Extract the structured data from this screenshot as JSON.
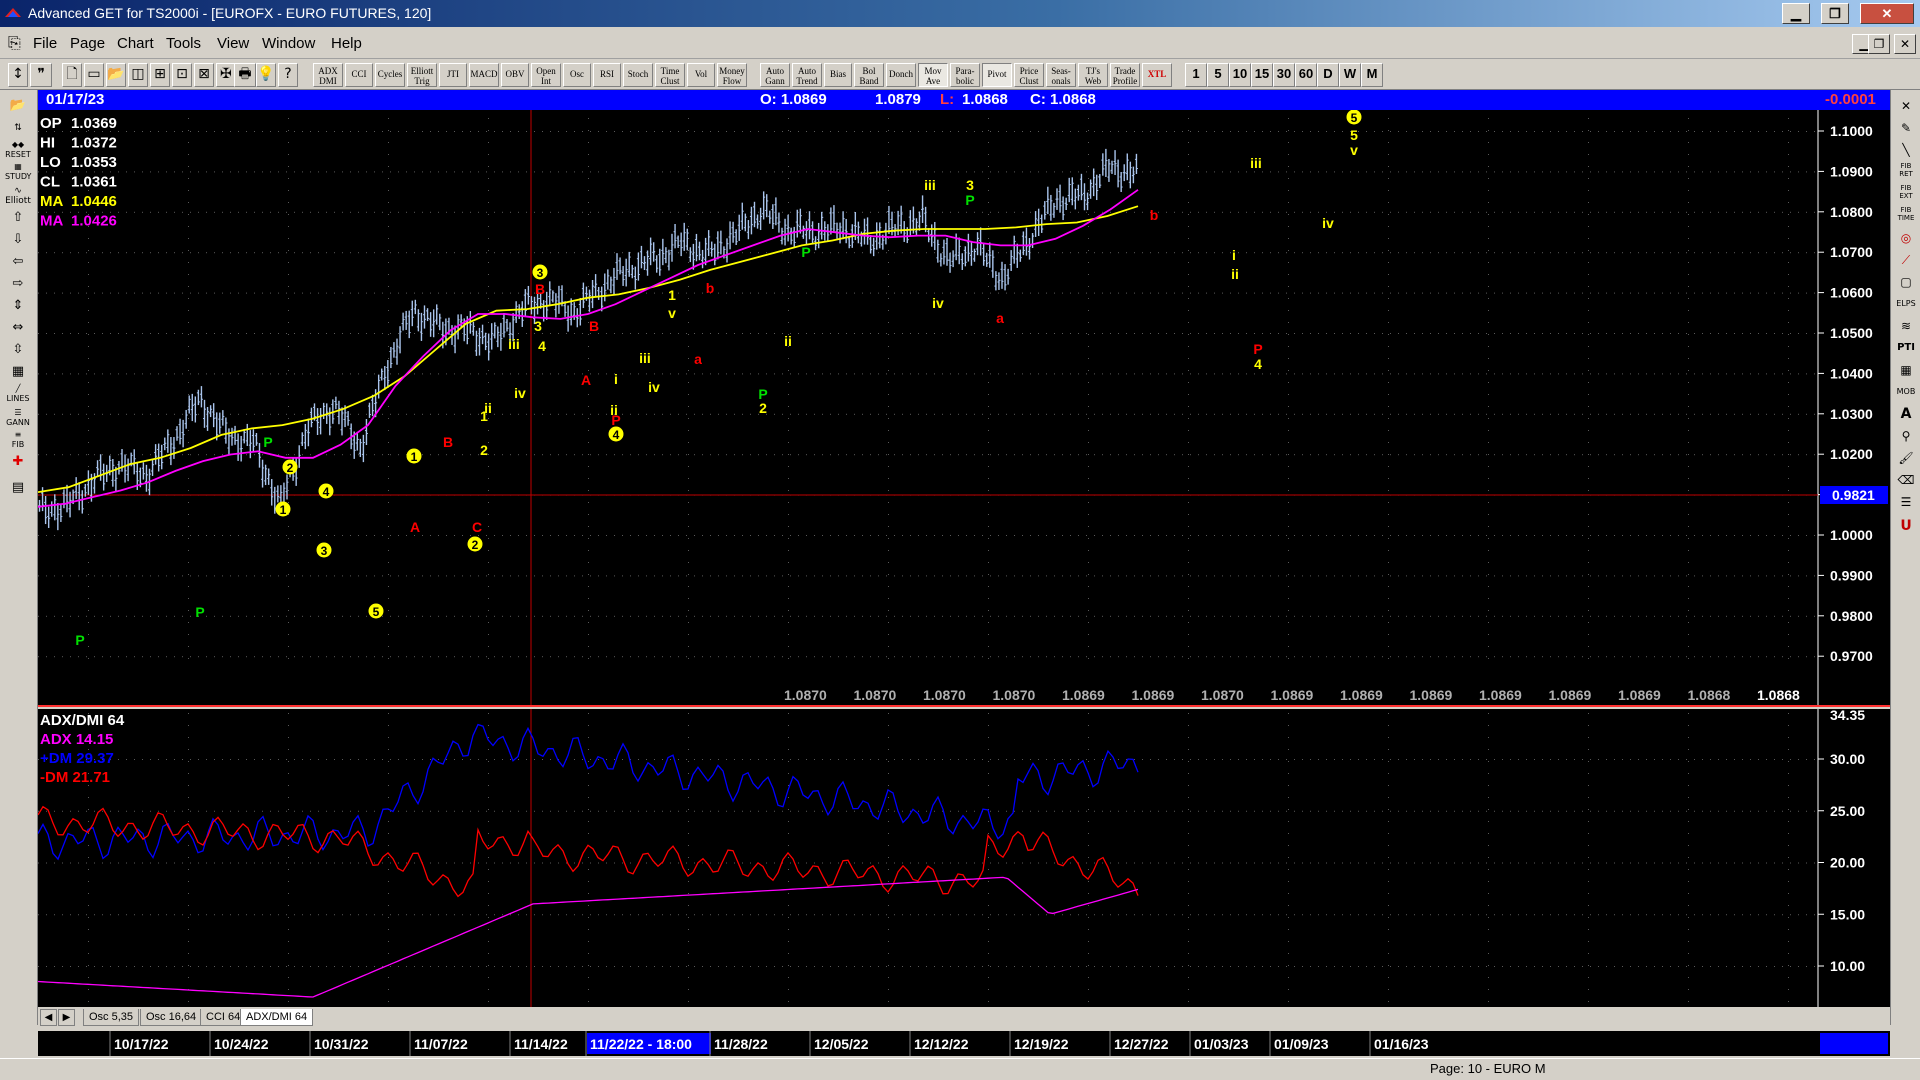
{
  "window": {
    "title": "Advanced GET for TS2000i - [EUROFX - EURO FUTURES, 120]",
    "min": "▁",
    "max": "❐",
    "close": "✕"
  },
  "menu": [
    "File",
    "Page",
    "Chart",
    "Tools",
    "View",
    "Window",
    "Help"
  ],
  "mdi_buttons": [
    "▁",
    "❐",
    "✕"
  ],
  "toolbar": {
    "icon_buttons": [
      "↕",
      "❞",
      "🗋",
      "▭",
      "📂",
      "◫",
      "⊞",
      "⊡",
      "⊠",
      "✠",
      "🖶",
      "💡",
      "?"
    ],
    "study_buttons": [
      "ADX DMI",
      "CCI",
      "Cycles",
      "Elliott Trig",
      "JTI",
      "MACD",
      "OBV",
      "Open Int",
      "Osc",
      "RSI",
      "Stoch",
      "Time Clust",
      "Vol",
      "Money Flow",
      "Auto Gann",
      "Auto Trend",
      "Bias",
      "Bol Band",
      "Donch",
      "Mov Ave",
      "Para- bolic",
      "Pivot",
      "Price Clust",
      "Seas- onals",
      "TJ's Web",
      "Trade Profile",
      "XTL"
    ],
    "timeframes": [
      "1",
      "5",
      "10",
      "15",
      "30",
      "60",
      "D",
      "W",
      "M"
    ]
  },
  "info_bar": {
    "date": "01/17/23",
    "open": "O: 1.0869",
    "high": "1.0879",
    "low_label": "L:",
    "low": "1.0868",
    "close": "C: 1.0868",
    "change": "-0.0001"
  },
  "legend": [
    {
      "label": "OP",
      "value": "1.0369",
      "color": "#ffffff"
    },
    {
      "label": "HI",
      "value": "1.0372",
      "color": "#ffffff"
    },
    {
      "label": "LO",
      "value": "1.0353",
      "color": "#ffffff"
    },
    {
      "label": "CL",
      "value": "1.0361",
      "color": "#ffffff"
    },
    {
      "label": "MA",
      "value": "1.0446",
      "color": "#ffff00"
    },
    {
      "label": "MA",
      "value": "1.0426",
      "color": "#ff00ff"
    }
  ],
  "price_axis": [
    "1.1000",
    "1.0900",
    "1.0800",
    "1.0700",
    "1.0600",
    "1.0500",
    "1.0400",
    "1.0300",
    "1.0200",
    "1.0100",
    "1.0000",
    "0.9900",
    "0.9800",
    "0.9700"
  ],
  "cursor_price": "0.9821",
  "price_strip": [
    "1.0870",
    "1.0870",
    "1.0870",
    "1.0870",
    "1.0869",
    "1.0869",
    "1.0870",
    "1.0869",
    "1.0869",
    "1.0869",
    "1.0869",
    "1.0869",
    "1.0869",
    "1.0868",
    "1.0868"
  ],
  "osc_legend": {
    "title": "ADX/DMI 64",
    "adx": "ADX 14.15",
    "pdm": "+DM 29.37",
    "mdm": "-DM 21.71"
  },
  "osc_axis": [
    "34.35",
    "30.00",
    "25.00",
    "20.00",
    "15.00",
    "10.00"
  ],
  "osc_tabs": [
    "Osc 5,35",
    "Osc 16,64",
    "CCI 64",
    "ADX/DMI 64"
  ],
  "dates": [
    "10/17/22",
    "10/24/22",
    "10/31/22",
    "11/07/22",
    "11/14/22",
    "11/22/22 - 18:00",
    "11/28/22",
    "12/05/22",
    "12/12/22",
    "12/19/22",
    "12/27/22",
    "01/03/23",
    "01/09/23",
    "01/16/23"
  ],
  "status": {
    "page": "Page: 10 - EURO M"
  },
  "colors": {
    "price": "#a9c4ec",
    "ma_fast": "#ffff00",
    "ma_slow": "#ff00ff",
    "adx": "#ff00ff",
    "pdm": "#0000ff",
    "mdm": "#ff0000",
    "label_yellow": "#ffff00",
    "label_red": "#ff0000",
    "label_green": "#00e000"
  },
  "chart_data": {
    "type": "ohlc",
    "series": [
      {
        "name": "Price",
        "values": [
          0.9838,
          0.9852,
          0.993,
          0.9978,
          0.9948,
          1.0052,
          1.018,
          1.0069,
          1.0045,
          0.9852,
          1.0088,
          1.0158,
          1.0032,
          1.0285,
          1.045,
          1.0396,
          1.0391,
          1.0354,
          1.0452,
          1.0487,
          1.0445,
          1.0521,
          1.0578,
          1.0608,
          1.066,
          1.062,
          1.0683,
          1.076,
          1.0694,
          1.0693,
          1.0705,
          1.0665,
          1.0706,
          1.0726,
          1.06,
          1.065,
          1.0547,
          1.0673,
          1.079,
          1.0802,
          1.089,
          1.0868
        ]
      },
      {
        "name": "MA",
        "values": [
          0.9895,
          0.991,
          0.9945,
          0.998,
          1.0,
          1.003,
          1.007,
          1.009,
          1.01,
          1.012,
          1.015,
          1.019,
          1.025,
          1.033,
          1.041,
          1.045,
          1.0455,
          1.047,
          1.049,
          1.05,
          1.052,
          1.0545,
          1.0575,
          1.06,
          1.0625,
          1.065,
          1.0665,
          1.0685,
          1.0695,
          1.07,
          1.07,
          1.07,
          1.0705,
          1.0715,
          1.072,
          1.074,
          1.077
        ]
      },
      {
        "name": "MA",
        "values": [
          0.985,
          0.986,
          0.988,
          0.99,
          0.9925,
          0.996,
          0.999,
          1.001,
          1.002,
          1.0,
          1.0,
          1.004,
          1.01,
          1.022,
          1.031,
          1.039,
          1.044,
          1.044,
          1.043,
          1.0425,
          1.044,
          1.047,
          1.051,
          1.055,
          1.059,
          1.062,
          1.065,
          1.068,
          1.07,
          1.069,
          1.068,
          1.0675,
          1.068,
          1.068,
          1.066,
          1.065,
          1.065,
          1.067,
          1.071,
          1.076,
          1.082
        ]
      }
    ]
  }
}
